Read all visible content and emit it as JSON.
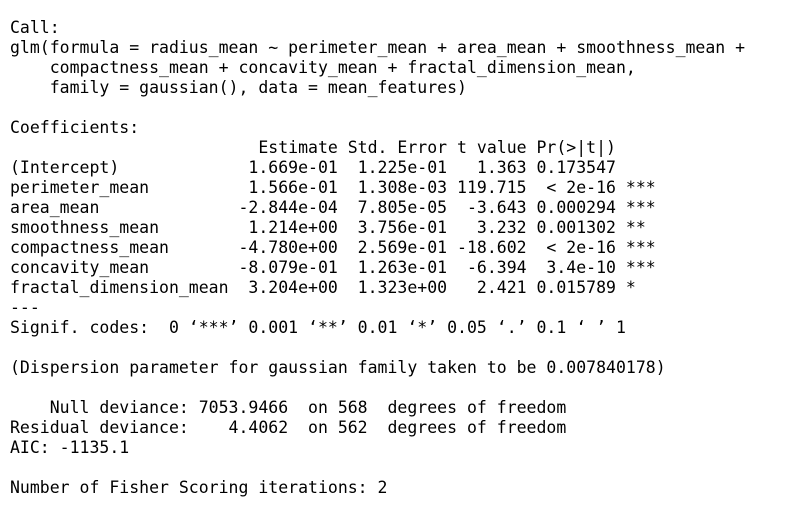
{
  "console": {
    "lines": [
      "Call:",
      "glm(formula = radius_mean ~ perimeter_mean + area_mean + smoothness_mean +",
      "    compactness_mean + concavity_mean + fractal_dimension_mean,",
      "    family = gaussian(), data = mean_features)",
      "",
      "Coefficients:",
      "                         Estimate Std. Error t value Pr(>|t|)    ",
      "(Intercept)             1.669e-01  1.225e-01   1.363 0.173547    ",
      "perimeter_mean          1.566e-01  1.308e-03 119.715  < 2e-16 ***",
      "area_mean              -2.844e-04  7.805e-05  -3.643 0.000294 ***",
      "smoothness_mean         1.214e+00  3.756e-01   3.232 0.001302 ** ",
      "compactness_mean       -4.780e+00  2.569e-01 -18.602  < 2e-16 ***",
      "concavity_mean         -8.079e-01  1.263e-01  -6.394  3.4e-10 ***",
      "fractal_dimension_mean  3.204e+00  1.323e+00   2.421 0.015789 *  ",
      "---",
      "Signif. codes:  0 ‘***’ 0.001 ‘**’ 0.01 ‘*’ 0.05 ‘.’ 0.1 ‘ ’ 1",
      "",
      "(Dispersion parameter for gaussian family taken to be 0.007840178)",
      "",
      "    Null deviance: 7053.9466  on 568  degrees of freedom",
      "Residual deviance:    4.4062  on 562  degrees of freedom",
      "AIC: -1135.1",
      "",
      "Number of Fisher Scoring iterations: 2"
    ]
  }
}
